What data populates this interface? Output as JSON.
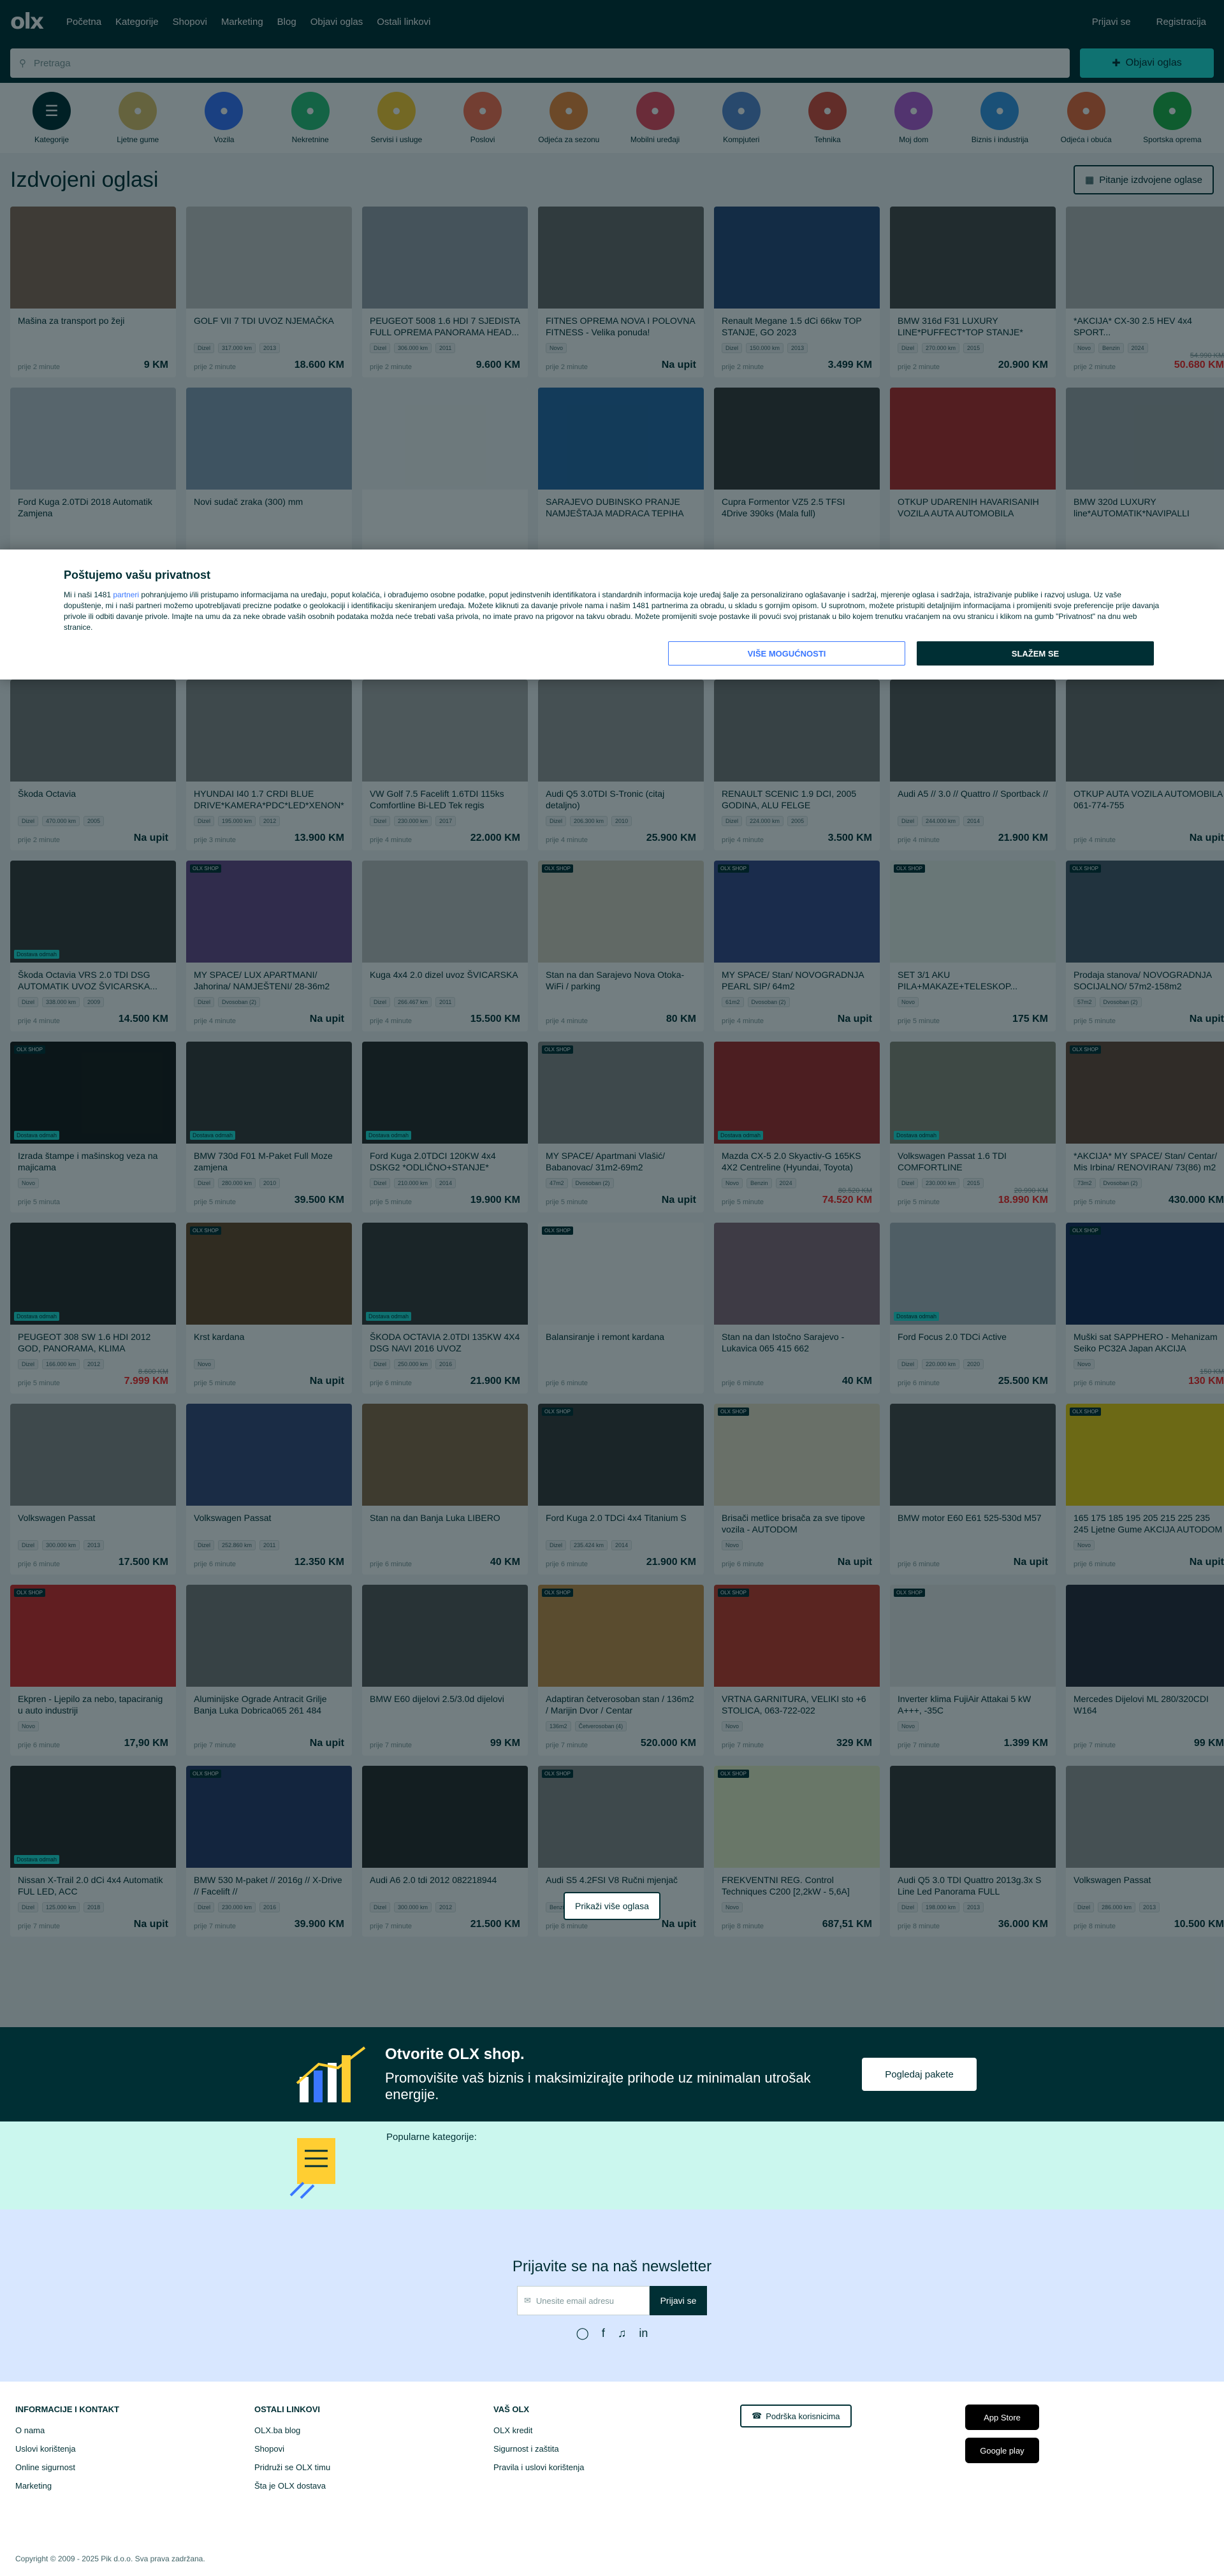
{
  "nav": {
    "logo": "olx",
    "links": [
      "Početna",
      "Kategorije",
      "Shopovi",
      "Marketing",
      "Blog",
      "Objavi oglas",
      "Ostali linkovi"
    ],
    "login": "Prijavi se",
    "register": "Registracija"
  },
  "search": {
    "placeholder": "Pretraga",
    "publish": "Objavi oglas"
  },
  "categories": [
    {
      "label": "Kategorije",
      "color": "#002f34"
    },
    {
      "label": "Ljetne gume",
      "color": "#e0c36a"
    },
    {
      "label": "Vozila",
      "color": "#3a77ff"
    },
    {
      "label": "Nekretnine",
      "color": "#2dc37a"
    },
    {
      "label": "Servisi i usluge",
      "color": "#ffce32"
    },
    {
      "label": "Poslovi",
      "color": "#ff7250"
    },
    {
      "label": "Odjeća za sezonu",
      "color": "#f08a3a"
    },
    {
      "label": "Mobilni uređaji",
      "color": "#ea4a5f"
    },
    {
      "label": "Kompjuteri",
      "color": "#5a8ad2"
    },
    {
      "label": "Tehnika",
      "color": "#d94c3c"
    },
    {
      "label": "Moj dom",
      "color": "#b75cd8"
    },
    {
      "label": "Biznis i industrija",
      "color": "#3a9ae8"
    },
    {
      "label": "Odjeća i obuća",
      "color": "#ee6a3a"
    },
    {
      "label": "Sportska oprema",
      "color": "#23b34a"
    }
  ],
  "featured_title": "Izdvojeni oglasi",
  "featured_button": "Pitanje izdvojene oglase",
  "featured": [
    {
      "title": "Mašina za transport po žeji",
      "tags": [],
      "time": "prije 2 minute",
      "price": "9 KM",
      "c": "#8a6a5a"
    },
    {
      "title": "GOLF VII 7 TDI UVOZ NJEMAČKA",
      "tags": [
        "Dizel",
        "317.000 km",
        "2013"
      ],
      "time": "prije 2 minute",
      "price": "18.600 KM",
      "c": "#c8c8c8"
    },
    {
      "title": "PEUGEOT 5008 1.6 HDI 7 SJEDISTA FULL OPREMA PANORAMA HEAD...",
      "tags": [
        "Dizel",
        "306.000 km",
        "2011"
      ],
      "time": "prije 2 minute",
      "price": "9.600 KM",
      "c": "#9aa1aa"
    },
    {
      "title": "FITNES OPREMA NOVA I POLOVNA FITNESS - Velika ponuda!",
      "tags": [
        "Novo"
      ],
      "time": "prije 2 minute",
      "price": "Na upit",
      "c": "#6a6a6a"
    },
    {
      "title": "Renault Megane 1.5 dCi 66kw TOP STANJE, GO 2023",
      "tags": [
        "Dizel",
        "150.000 km",
        "2013"
      ],
      "time": "prije 2 minute",
      "price": "3.499 KM",
      "c": "#2a4a7a"
    },
    {
      "title": "BMW 316d F31 LUXURY LINE*PUFFECT*TOP STANJE*",
      "tags": [
        "Dizel",
        "270.000 km",
        "2015"
      ],
      "time": "prije 2 minute",
      "price": "20.900 KM",
      "c": "#4a4a4a"
    },
    {
      "title": "*AKCIJA* CX-30 2.5 HEV 4x4 SPORT...",
      "tags": [
        "Novo",
        "Benzin",
        "2024"
      ],
      "time": "prije 2 minute",
      "price": "50.680 KM",
      "old": "54.990 KM",
      "red": true,
      "c": "#b8b8b8"
    },
    {
      "title": "Ford Kuga 2.0TDi 2018 Automatik Zamjena",
      "tags": [],
      "time": "",
      "price": "",
      "c": "#c0c8d0"
    },
    {
      "title": "Novi sudač zraka (300) mm",
      "tags": [],
      "time": "",
      "price": "",
      "c": "#8aa0b8"
    },
    {
      "title": "",
      "tags": [],
      "time": "",
      "price": "",
      "c": "#f2f4f5"
    },
    {
      "title": "SARAJEVO DUBINSKO PRANJE NAMJEŠTAJA MADRACA TEPIHA",
      "tags": [],
      "time": "",
      "price": "",
      "c": "#2a6aa8"
    },
    {
      "title": "Cupra Formentor VZ5 2.5 TFSI 4Drive 390ks (Mala full)",
      "tags": [],
      "time": "",
      "price": "",
      "c": "#3a3a3a"
    },
    {
      "title": "OTKUP UDARENIH HAVARISANIH VOZILA AUTA AUTOMOBILA",
      "tags": [],
      "time": "",
      "price": "",
      "c": "#b82a2a"
    },
    {
      "title": "BMW 320d LUXURY line*AUTOMATIK*NAVIPALLI",
      "tags": [],
      "time": "",
      "price": "",
      "c": "#a0a4a8"
    }
  ],
  "consent": {
    "title": "Poštujemo vašu privatnost",
    "text_a": "Mi i naši 1481 ",
    "partners": "partneri",
    "text_b": " pohranjujemo i/ili pristupamo informacijama na uređaju, poput kolačića, i obrađujemo osobne podatke, poput jedinstvenih identifikatora i standardnih informacija koje uređaj šalje za personalizirano oglašavanje i sadržaj, mjerenje oglasa i sadržaja, istraživanje publike i razvoj usluga. Uz vaše dopuštenje, mi i naši partneri možemo upotrebljavati precizne podatke o geolokaciji i identifikaciju skeniranjem uređaja. Možete kliknuti za davanje privole nama i našim 1481 partnerima za obradu, u skladu s gornjim opisom. U suprotnom, možete pristupiti detaljnijim informacijama i promijeniti svoje preferencije prije davanja privole ili odbiti davanje privole. Imajte na umu da za neke obrade vaših osobnih podataka možda neće trebati vaša privola, no imate pravo na prigovor na takvu obradu. Možete promijeniti svoje postavke ili povući svoj pristanak u bilo kojem trenutku vraćanjem na ovu stranicu i klikom na gumb \"Privatnost\" na dnu web stranice.",
    "more": "VIŠE MOGUĆNOSTI",
    "agree": "SLAŽEM SE"
  },
  "listings": [
    {
      "title": "Škoda Octavia",
      "tags": [
        "Dizel",
        "470.000 km",
        "2005"
      ],
      "time": "prije 2 minute",
      "price": "Na upit",
      "c": "#7a7a7a"
    },
    {
      "title": "HYUNDAI I40 1.7 CRDI BLUE DRIVE*KAMERA*PDC*LED*XENON*",
      "tags": [
        "Dizel",
        "195.000 km",
        "2012"
      ],
      "time": "prije 3 minute",
      "price": "13.900 KM",
      "c": "#8a8a8a"
    },
    {
      "title": "VW Golf 7.5 Facelift 1.6TDI 115ks Comfortline Bi-LED Tek regis",
      "tags": [
        "Dizel",
        "230.000 km",
        "2017"
      ],
      "time": "prije 4 minute",
      "price": "22.000 KM",
      "c": "#aaaaaa"
    },
    {
      "title": "Audi Q5 3.0TDI S-Tronic (citaj detaljno)",
      "tags": [
        "Dizel",
        "206.300 km",
        "2010"
      ],
      "time": "prije 4 minute",
      "price": "25.900 KM",
      "c": "#9a9a9a"
    },
    {
      "title": "RENAULT SCENIC 1.9 DCI, 2005 GODINA, ALU FELGE",
      "tags": [
        "Dizel",
        "224.000 km",
        "2005"
      ],
      "time": "prije 4 minute",
      "price": "3.500 KM",
      "c": "#7a7a7a"
    },
    {
      "title": "Audi A5 // 3.0 // Quattro // Sportback //",
      "tags": [
        "Dizel",
        "244.000 km",
        "2014"
      ],
      "time": "prije 4 minute",
      "price": "21.900 KM",
      "c": "#5a5a5a"
    },
    {
      "title": "OTKUP AUTA VOZILA AUTOMOBILA 061-774-755",
      "tags": [],
      "time": "prije 4 minute",
      "price": "Na upit",
      "c": "#6a6a6a"
    },
    {
      "title": "Škoda Octavia VRS 2.0 TDI DSG AUTOMATIK UVOZ ŠVICARSKA...",
      "tags": [
        "Dizel",
        "338.000 km",
        "2009"
      ],
      "time": "prije 4 minute",
      "price": "14.500 KM",
      "c": "#3a3a3a",
      "badge": true
    },
    {
      "title": "MY SPACE/ LUX APARTMANI/ Jahorina/ NAMJEŠTENI/ 28-36m2",
      "tags": [
        "Dizel",
        "Dvosoban (2)"
      ],
      "time": "prije 4 minute",
      "price": "Na upit",
      "c": "#6a4a8a",
      "shop": true
    },
    {
      "title": "Kuga 4x4 2.0 dizel uvoz ŠVICARSKA",
      "tags": [
        "Dizel",
        "266.467 km",
        "2011"
      ],
      "time": "prije 4 minute",
      "price": "15.500 KM",
      "c": "#c0c0c0"
    },
    {
      "title": "Stan na dan Sarajevo Nova Otoka-WiFi / parking",
      "tags": [],
      "time": "prije 4 minute",
      "price": "80 KM",
      "c": "#d8d0c0",
      "shop": true
    },
    {
      "title": "MY SPACE/ Stan/ NOVOGRADNJA PEARL SIP/ 64m2",
      "tags": [
        "61m2",
        "Dvosoban (2)"
      ],
      "time": "prije 4 minute",
      "price": "Na upit",
      "c": "#3a4a8a",
      "shop": true
    },
    {
      "title": "SET 3/1 AKU PILA+MAKAZE+TELESKOP...",
      "tags": [
        "Novo"
      ],
      "time": "prije 5 minute",
      "price": "175 KM",
      "c": "#e8f0e8",
      "shop": true
    },
    {
      "title": "Prodaja stanova/ NOVOGRADNJA SOCIJALNO/ 57m2-158m2",
      "tags": [
        "57m2",
        "Dvosoban (2)"
      ],
      "time": "prije 5 minute",
      "price": "Na upit",
      "c": "#4a5a6a",
      "shop": true
    },
    {
      "title": "Izrada štampe i mašinskog veza na majicama",
      "tags": [
        "Novo"
      ],
      "time": "prije 5 minuta",
      "price": "",
      "c": "#1a1a1a",
      "shop": true,
      "badge": true
    },
    {
      "title": "BMW 730d F01 M-Paket Full Moze zamjena",
      "tags": [
        "Dizel",
        "280.000 km",
        "2010"
      ],
      "time": "prije 5 minute",
      "price": "39.500 KM",
      "c": "#3a3a3a",
      "badge": true
    },
    {
      "title": "Ford Kuga 2.0TDCI 120KW 4x4 DSKG2 *ODLIČNO+STANJE*",
      "tags": [
        "Dizel",
        "210.000 km",
        "2014"
      ],
      "time": "prije 5 minute",
      "price": "19.900 KM",
      "c": "#2a2a2a",
      "badge": true
    },
    {
      "title": "MY SPACE/ Apartmani Vlašić/ Babanovac/ 31m2-69m2",
      "tags": [
        "47m2",
        "Dvosoban (2)"
      ],
      "time": "prije 5 minute",
      "price": "Na upit",
      "c": "#8a8a8a",
      "shop": true
    },
    {
      "title": "Mazda CX-5 2.0 Skyactiv-G 165KS 4X2 Centreline (Hyundai, Toyota)",
      "tags": [
        "Novo",
        "Benzin",
        "2024"
      ],
      "time": "prije 5 minute",
      "price": "74.520 KM",
      "old": "80.520 KM",
      "red": true,
      "c": "#a82a2a",
      "badge": true
    },
    {
      "title": "Volkswagen Passat 1.6 TDI COMFORTLINE",
      "tags": [
        "Dizel",
        "230.000 km",
        "2015"
      ],
      "time": "prije 5 minute",
      "price": "18.990 KM",
      "old": "20.990 KM",
      "red": true,
      "c": "#8a8a7a",
      "badge": true
    },
    {
      "title": "*AKCIJA* MY SPACE/ Stan/ Centar/ Mis Irbina/ RENOVIRAN/ 73(86) m2",
      "tags": [
        "73m2",
        "Dvosoban (2)"
      ],
      "time": "prije 5 minute",
      "price": "430.000 KM",
      "c": "#6a4a3a",
      "shop": true
    },
    {
      "title": "PEUGEOT 308 SW 1.6 HDI 2012 GOD, PANORAMA, KLIMA",
      "tags": [
        "Dizel",
        "166.000 km",
        "2012"
      ],
      "time": "prije 5 minute",
      "price": "7.999 KM",
      "old": "8.600 KM",
      "red": true,
      "c": "#2a2a2a",
      "badge": true
    },
    {
      "title": "Krst kardana",
      "tags": [
        "Novo"
      ],
      "time": "prije 5 minute",
      "price": "Na upit",
      "c": "#6a4a2a",
      "shop": true
    },
    {
      "title": "ŠKODA OCTAVIA 2.0TDI 135KW 4X4 DSG NAVI 2016 UVOZ",
      "tags": [
        "Dizel",
        "250.000 km",
        "2016"
      ],
      "time": "prije 6 minute",
      "price": "21.900 KM",
      "c": "#3a3a3a",
      "badge": true
    },
    {
      "title": "Balansiranje i remont kardana",
      "tags": [],
      "time": "prije 6 minute",
      "price": "",
      "c": "#f8f8f8",
      "shop": true
    },
    {
      "title": "Stan na dan Istočno Sarajevo - Lukavica 065 415 662",
      "tags": [],
      "time": "prije 6 minute",
      "price": "40 KM",
      "c": "#8a6a7a"
    },
    {
      "title": "Ford Focus 2.0 TDCi Active",
      "tags": [
        "Dizel",
        "220.000 km",
        "2020"
      ],
      "time": "prije 6 minute",
      "price": "25.500 KM",
      "c": "#b0b8c0",
      "badge": true
    },
    {
      "title": "Muški sat SAPPHERO - Mehanizam Seiko PC32A Japan AKCIJA",
      "tags": [
        "Novo"
      ],
      "time": "prije 6 minute",
      "price": "130 KM",
      "old": "150 KM",
      "red": true,
      "c": "#1a2a5a",
      "shop": true
    },
    {
      "title": "Volkswagen Passat",
      "tags": [
        "Dizel",
        "300.000 km",
        "2013"
      ],
      "time": "prije 6 minute",
      "price": "17.500 KM",
      "c": "#8a8a8a"
    },
    {
      "title": "Volkswagen Passat",
      "tags": [
        "Dizel",
        "252.860 km",
        "2011"
      ],
      "time": "prije 6 minute",
      "price": "12.350 KM",
      "c": "#3a4a7a"
    },
    {
      "title": "Stan na dan Banja Luka LIBERO",
      "tags": [],
      "time": "prije 6 minute",
      "price": "40 KM",
      "c": "#8a6a4a"
    },
    {
      "title": "Ford Kuga 2.0 TDCi 4x4 Titanium S",
      "tags": [
        "Dizel",
        "235.424 km",
        "2014"
      ],
      "time": "prije 6 minute",
      "price": "21.900 KM",
      "c": "#3a3a3a",
      "shop": true
    },
    {
      "title": "Brisači metlice brisača za sve tipove vozila - AUTODOM",
      "tags": [
        "Novo"
      ],
      "time": "prije 6 minute",
      "price": "Na upit",
      "c": "#e8e0c8",
      "shop": true
    },
    {
      "title": "BMW motor E60 E61 525-530d M57",
      "tags": [],
      "time": "prije 6 minute",
      "price": "Na upit",
      "c": "#4a4a4a"
    },
    {
      "title": "165 175 185 195 205 215 225 235 245 Ljetne Gume AKCIJA AUTODOM",
      "tags": [
        "Novo"
      ],
      "time": "prije 6 minute",
      "price": "Na upit",
      "c": "#f0d010",
      "shop": true
    },
    {
      "title": "Ekpren - Ljepilo za nebo, tapaciranig u auto industriji",
      "tags": [
        "Novo"
      ],
      "time": "prije 6 minute",
      "price": "17,90 KM",
      "c": "#d82a2a",
      "shop": true
    },
    {
      "title": "Aluminijske Ograde Antracit Grilje Banja Luka Dobrica065 261 484",
      "tags": [],
      "time": "prije 7 minute",
      "price": "Na upit",
      "c": "#7a7a7a"
    },
    {
      "title": "BMW E60 dijelovi 2.5/3.0d dijelovi",
      "tags": [],
      "time": "prije 7 minute",
      "price": "99 KM",
      "c": "#5a5a5a"
    },
    {
      "title": "Adaptiran četverosoban stan / 136m2 / Marijin Dvor / Centar",
      "tags": [
        "136m2",
        "Četverosoban (4)"
      ],
      "time": "prije 7 minute",
      "price": "520.000 KM",
      "c": "#c8904a",
      "shop": true
    },
    {
      "title": "VRTNA GARNITURA, VELIKI sto +6 STOLICA, 063-722-022",
      "tags": [
        "Novo"
      ],
      "time": "prije 7 minute",
      "price": "329 KM",
      "c": "#c83a2a",
      "shop": true
    },
    {
      "title": "Inverter klima FujiAir Attakai 5 kW A+++, -35C",
      "tags": [
        "Novo"
      ],
      "time": "prije 7 minute",
      "price": "1.399 KM",
      "c": "#e8e8e8",
      "shop": true
    },
    {
      "title": "Mercedes Dijelovi ML 280/320CDI W164",
      "tags": [],
      "time": "prije 7 minute",
      "price": "99 KM",
      "c": "#2a2a3a"
    },
    {
      "title": "Nissan X-Trail 2.0 dCi 4x4 Automatik FUL LED, ACC",
      "tags": [
        "Dizel",
        "125.000 km",
        "2018"
      ],
      "time": "prije 7 minute",
      "price": "Na upit",
      "c": "#2a2a2a",
      "badge": true
    },
    {
      "title": "BMW 530 M-paket // 2016g // X-Drive // Facelift //",
      "tags": [
        "Dizel",
        "230.000 km",
        "2016"
      ],
      "time": "prije 7 minute",
      "price": "39.900 KM",
      "c": "#2a3a6a",
      "shop": true
    },
    {
      "title": "Audi A6 2.0 tdi 2012 082218944",
      "tags": [
        "Dizel",
        "300.000 km",
        "2012"
      ],
      "time": "prije 7 minute",
      "price": "21.500 KM",
      "c": "#2a2a2a"
    },
    {
      "title": "Audi S5 4.2FSI V8 Ručni mjenjač",
      "tags": [
        "Benzin",
        "245.000 km",
        "2008"
      ],
      "time": "prije 8 minute",
      "price": "Na upit",
      "c": "#8a8a8a",
      "shop": true
    },
    {
      "title": "FREKVENTNI REG. Control Techniques C200 [2,2kW - 5,6A]",
      "tags": [
        "Novo"
      ],
      "time": "prije 8 minute",
      "price": "687,51 KM",
      "c": "#e8f0c8",
      "shop": true
    },
    {
      "title": "Audi Q5 3.0 TDI Quattro 2013g.3x S Line Led Panorama FULL",
      "tags": [
        "Dizel",
        "198.000 km",
        "2013"
      ],
      "time": "prije 8 minute",
      "price": "36.000 KM",
      "c": "#3a3a3a"
    },
    {
      "title": "Volkswagen Passat",
      "tags": [
        "Dizel",
        "286.000 km",
        "2013"
      ],
      "time": "prije 8 minute",
      "price": "10.500 KM",
      "c": "#9a9a9a"
    }
  ],
  "shop_badge": "OLX SHOP",
  "promo_badge": "Dostava odmah",
  "more_button": "Prikaži više oglasa",
  "shop": {
    "title": "Otvorite OLX shop.",
    "text": "Promovišite vaš biznis i maksimizirajte prihode uz minimalan utrošak energije.",
    "button": "Pogledaj pakete"
  },
  "popular": "Popularne kategorije:",
  "newsletter": {
    "title": "Prijavite se na naš newsletter",
    "placeholder": "Unesite email adresu",
    "button": "Prijavi se"
  },
  "footer": {
    "col1": {
      "title": "INFORMACIJE I KONTAKT",
      "links": [
        "O nama",
        "Uslovi korištenja",
        "Online sigurnost",
        "Marketing"
      ]
    },
    "col2": {
      "title": "OSTALI LINKOVI",
      "links": [
        "OLX.ba blog",
        "Shopovi",
        "Pridruži se OLX timu",
        "Šta je OLX dostava"
      ]
    },
    "col3": {
      "title": "VAŠ OLX",
      "links": [
        "OLX kredit",
        "Sigurnost i zaštita",
        "Pravila i uslovi korištenja"
      ]
    },
    "support": "Podrška korisnicima",
    "app_store": "App Store",
    "google_play": "Google play",
    "copyright": "Copyright © 2009 - 2025 Pik d.o.o. Sva prava zadržana."
  }
}
